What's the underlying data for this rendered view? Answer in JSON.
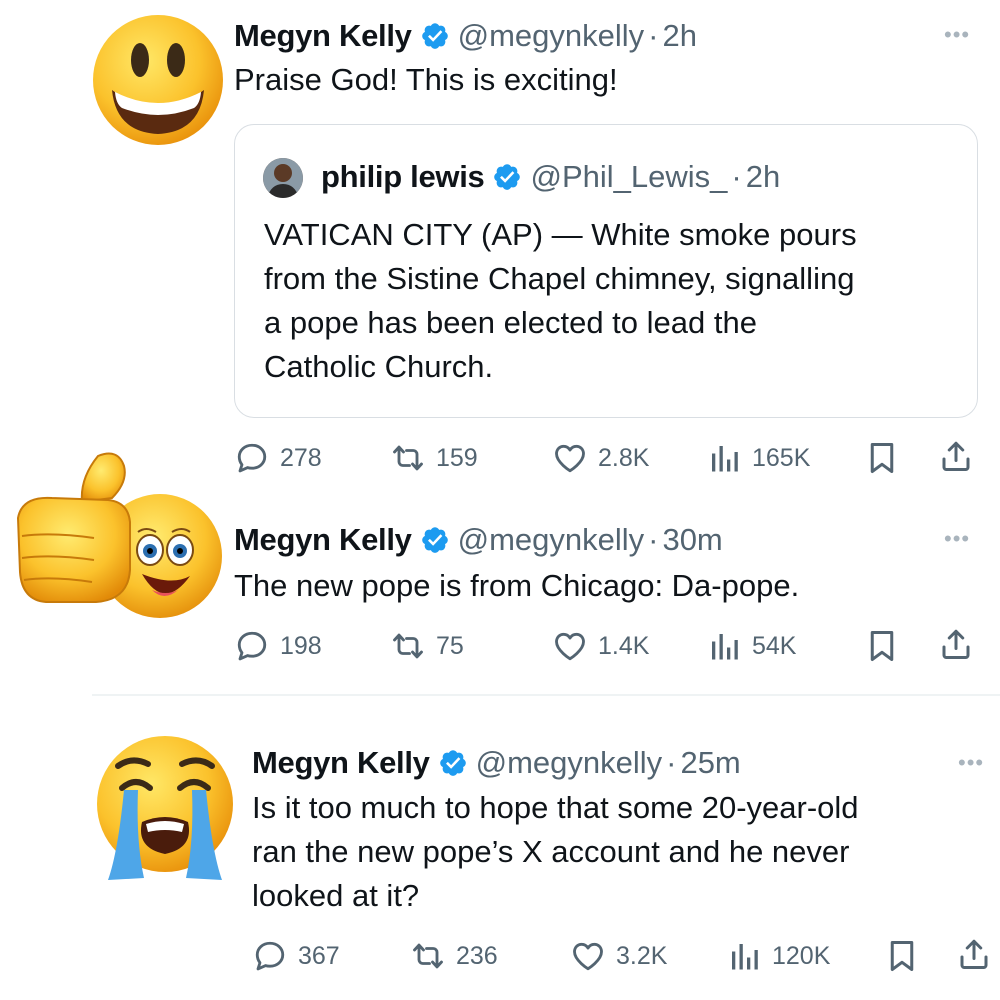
{
  "tweets": [
    {
      "name": "Megyn Kelly",
      "handle": "@megynkelly",
      "dot": "·",
      "time": "2h",
      "text": "Praise God! This is exciting!",
      "quote": {
        "name": "philip lewis",
        "handle": "@Phil_Lewis_",
        "dot": "·",
        "time": "2h",
        "lines": [
          "VATICAN CITY (AP) — White smoke pours",
          "from the Sistine Chapel chimney, signalling",
          "a pope has been elected to lead the",
          "Catholic Church."
        ]
      },
      "stats": {
        "replies": "278",
        "reposts": "159",
        "likes": "2.8K",
        "views": "165K"
      },
      "avatar_icon": "grinning-emoji-icon"
    },
    {
      "name": "Megyn Kelly",
      "handle": "@megynkelly",
      "dot": "·",
      "time": "30m",
      "text": "The new pope is from Chicago: Da-pope.",
      "stats": {
        "replies": "198",
        "reposts": "75",
        "likes": "1.4K",
        "views": "54K"
      },
      "avatar_icon": "thumbs-up-emoji-icon"
    },
    {
      "name": "Megyn Kelly",
      "handle": "@megynkelly",
      "dot": "·",
      "time": "25m",
      "lines": [
        "Is it too much to hope that some 20-year-old",
        "ran the new pope’s X account and he never",
        "looked at it?"
      ],
      "stats": {
        "replies": "367",
        "reposts": "236",
        "likes": "3.2K",
        "views": "120K"
      },
      "avatar_icon": "crying-emoji-icon"
    }
  ],
  "colors": {
    "verified": "#1d9bf0",
    "secondary_text": "#536471",
    "border": "#d9dee3"
  }
}
